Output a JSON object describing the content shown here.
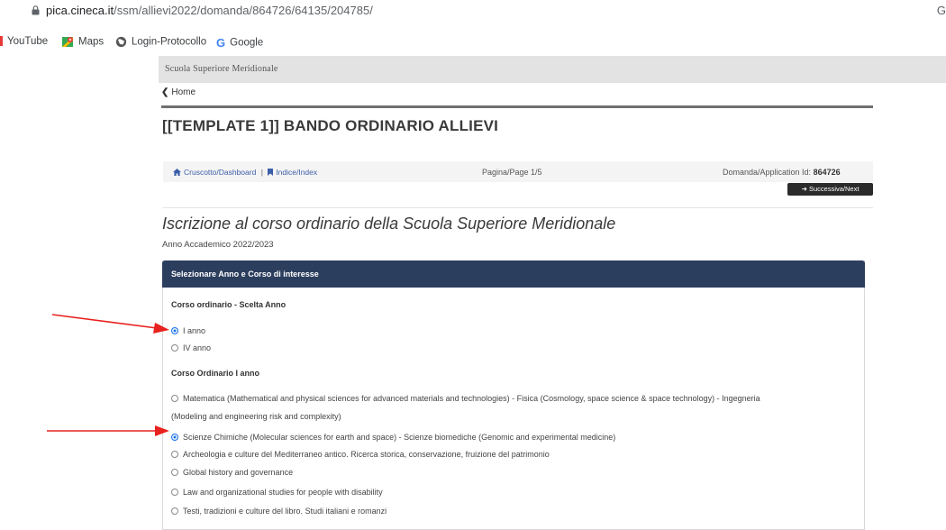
{
  "browser": {
    "url_host": "pica.cineca.it",
    "url_path": "/ssm/allievi2022/domanda/864726/64135/204785/",
    "bookmarks": [
      {
        "label": "YouTube",
        "icon": "youtube-icon"
      },
      {
        "label": "Maps",
        "icon": "maps-icon"
      },
      {
        "label": "Login-Protocollo",
        "icon": "globe-icon"
      },
      {
        "label": "Google",
        "icon": "google-icon"
      }
    ]
  },
  "site": {
    "name": "Scuola Superiore Meridionale",
    "home_label": "Home"
  },
  "page": {
    "title": "[[TEMPLATE 1]] BANDO ORDINARIO ALLIEVI"
  },
  "nav": {
    "dashboard": "Cruscotto/Dashboard",
    "divider": "|",
    "index": "Indice/Index",
    "page_indicator": "Pagina/Page 1/5",
    "application_label": "Domanda/Application Id:",
    "application_id": "864726",
    "next_label": "Successiva/Next"
  },
  "form": {
    "title": "Iscrizione al corso ordinario della Scuola Superiore Meridionale",
    "academic_year": "Anno Accademico 2022/2023",
    "panel_title": "Selezionare Anno e Corso di interesse",
    "year_group": {
      "label": "Corso ordinario - Scelta Anno",
      "options": [
        {
          "label": "I anno",
          "selected": true
        },
        {
          "label": "IV anno",
          "selected": false
        }
      ]
    },
    "course_group": {
      "label": "Corso Ordinario I anno",
      "options": [
        {
          "label": "Matematica (Mathematical and physical sciences for advanced materials and technologies) - Fisica (Cosmology, space science & space technology) - Ingegneria",
          "label_cont": "(Modeling and engineering risk and complexity)",
          "selected": false
        },
        {
          "label": "Scienze Chimiche (Molecular sciences for earth and space) - Scienze biomediche (Genomic and experimental medicine)",
          "selected": true
        },
        {
          "label": "Archeologia e culture del Mediterraneo antico. Ricerca storica, conservazione, fruizione del patrimonio",
          "selected": false
        },
        {
          "label": "Global history and governance",
          "selected": false
        },
        {
          "label": "Law and organizational studies for people with disability",
          "selected": false
        },
        {
          "label": "Testi, tradizioni e culture del libro. Studi italiani e romanzi",
          "selected": false
        }
      ]
    }
  },
  "colors": {
    "panel_header": "#2c3e5e",
    "link": "#3b5ea8",
    "radio_selected": "#1a73e8",
    "annotation_arrow": "#e8211e"
  }
}
